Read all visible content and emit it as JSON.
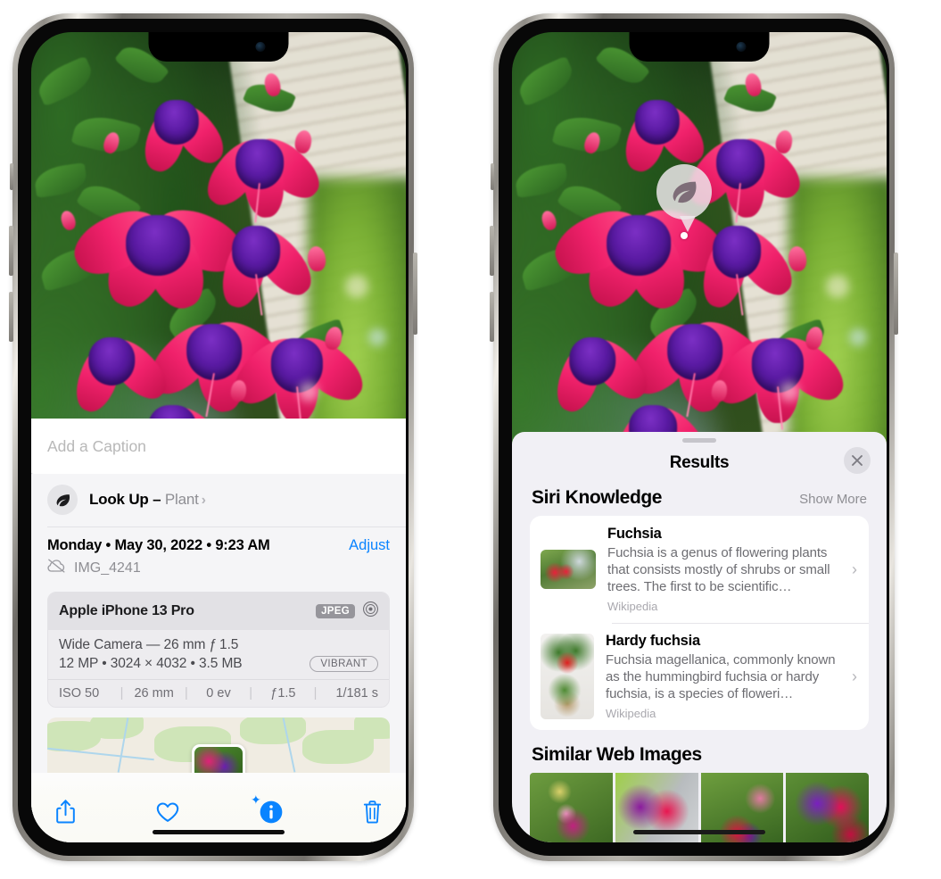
{
  "left_phone": {
    "caption_placeholder": "Add a Caption",
    "lookup": {
      "label": "Look Up – ",
      "subject": "Plant",
      "chevron": "›",
      "icon": "leaf-icon",
      "sparkle": "✦",
      "sparkle_small": "✦"
    },
    "meta": {
      "date": "Monday • May 30, 2022 • 9:23 AM",
      "adjust_label": "Adjust",
      "filename": "IMG_4241",
      "cloud_icon": "cloud-slash-icon"
    },
    "camera": {
      "model": "Apple iPhone 13 Pro",
      "format_badge": "JPEG",
      "aperture_icon": "aperture-icon",
      "lens": "Wide Camera — 26 mm ƒ 1.5",
      "size": "12 MP • 3024 × 4032 • 3.5 MB",
      "style_badge": "VIBRANT",
      "exif": [
        "ISO 50",
        "26 mm",
        "0 ev",
        "ƒ1.5",
        "1/181 s"
      ]
    },
    "toolbar": {
      "share_label": "share-icon",
      "favorite_label": "heart-icon",
      "info_label": "info-icon",
      "trash_label": "trash-icon"
    }
  },
  "right_phone": {
    "visual_lookup_pin": {
      "icon": "leaf-icon"
    },
    "results": {
      "title": "Results",
      "close_icon": "close-icon",
      "siri_section": {
        "title": "Siri Knowledge",
        "show_more": "Show More",
        "cards": [
          {
            "title": "Fuchsia",
            "description": "Fuchsia is a genus of flowering plants that consists mostly of shrubs or small trees. The first to be scientific…",
            "source": "Wikipedia",
            "chevron": "›",
            "thumb": "fuchsia-flowers-thumb"
          },
          {
            "title": "Hardy fuchsia",
            "description": "Fuchsia magellanica, commonly known as the hummingbird fuchsia or hardy fuchsia, is a species of floweri…",
            "source": "Wikipedia",
            "chevron": "›",
            "thumb": "hardy-fuchsia-specimen-thumb"
          }
        ]
      },
      "web_section": {
        "title": "Similar Web Images",
        "images": [
          "fuchsia-web-image-1",
          "fuchsia-web-image-2",
          "fuchsia-web-image-3",
          "fuchsia-web-image-4"
        ]
      }
    }
  },
  "colors": {
    "accent_blue": "#0a84ff",
    "sheet_gray": "#f1f0f5",
    "secondary_text": "#8e8e93"
  }
}
